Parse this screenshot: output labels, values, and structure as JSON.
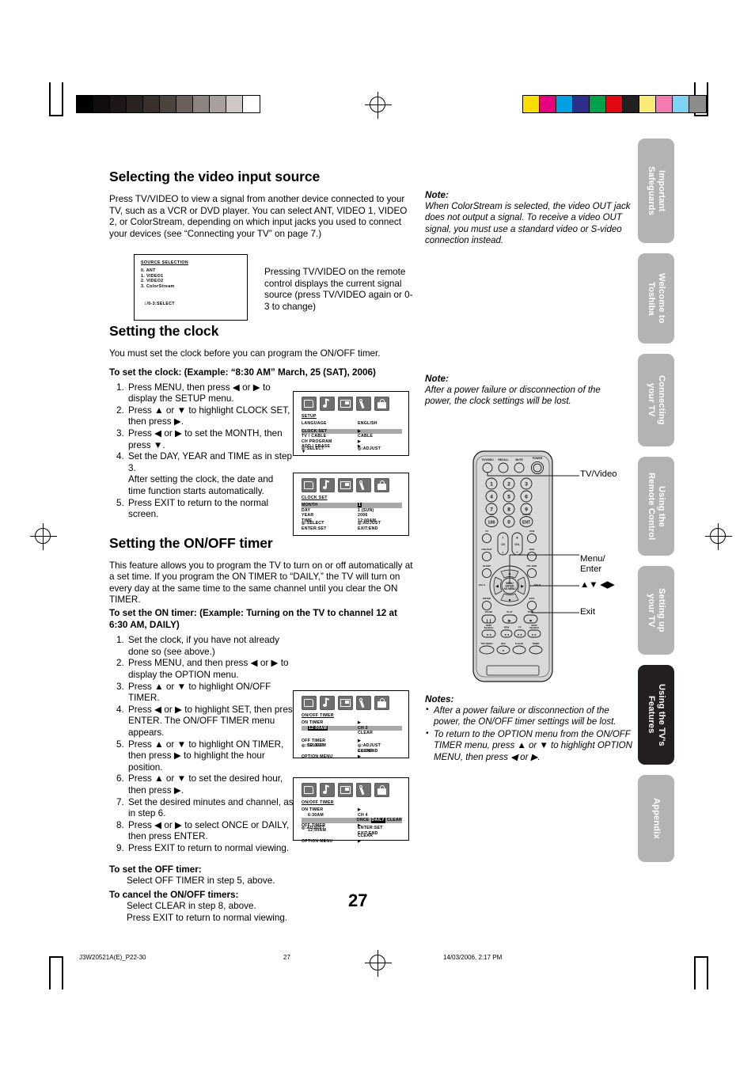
{
  "page": {
    "number": "27",
    "footer_left": "J3W20521A(E)_P22-30",
    "footer_center": "27",
    "footer_right": "14/03/2006, 2:17 PM"
  },
  "sidebar": {
    "tabs": [
      {
        "label": "Important\nSafeguards",
        "active": false
      },
      {
        "label": "Welcome to\nToshiba",
        "active": false
      },
      {
        "label": "Connecting\nyour TV",
        "active": false
      },
      {
        "label": "Using the\nRemote Control",
        "active": false
      },
      {
        "label": "Setting up\nyour TV",
        "active": false
      },
      {
        "label": "Using the TV's\nFeatures",
        "active": true
      },
      {
        "label": "Appendix",
        "active": false
      }
    ]
  },
  "section_video_input": {
    "heading": "Selecting the video input source",
    "paragraph": "Press TV/VIDEO to view a signal from another device connected to your TV, such as a VCR or DVD player. You can select ANT, VIDEO 1, VIDEO 2, or ColorStream, depending on which input jacks you used to connect your devices (see “Connecting your TV” on page 7.)",
    "caption": "Pressing TV/VIDEO on the remote control displays the current signal source (press TV/VIDEO again or 0-3 to change)",
    "osd": {
      "title": "SOURCE SELECTION",
      "items": [
        "0. ANT",
        "1. VIDEO1",
        "2. VIDEO2",
        "3. ColorStream"
      ],
      "footer": "0-3:SELECT"
    }
  },
  "note_colorstream": {
    "title": "Note:",
    "body": "When ColorStream is selected, the video OUT jack does not output a signal. To receive a video OUT signal, you must use a standard video or S-video connection instead."
  },
  "section_clock": {
    "heading": "Setting the clock",
    "paragraph": "You must set the clock before you can program the ON/OFF timer.",
    "subheading": "To set the clock: (Example: “8:30 AM” March, 25 (SAT), 2006)",
    "steps": [
      "Press MENU, then press ◀ or ▶ to display the SETUP menu.",
      "Press ▲ or ▼ to highlight CLOCK SET, then press ▶.",
      "Press ◀ or ▶ to set the MONTH, then press ▼.",
      "Set the DAY, YEAR and TIME as in step 3.",
      "Press EXIT to return to the normal screen."
    ],
    "step4_extra": "After setting the clock, the date and time function starts automatically.",
    "osd_setup": {
      "title": "SETUP",
      "rows": [
        {
          "label": "LANGUAGE",
          "value": "ENGLISH",
          "highlight": false
        },
        {
          "label": "CLOCK SET",
          "value": "▶",
          "highlight": true
        },
        {
          "label": "TV / CABLE",
          "value": "CABLE",
          "highlight": false
        },
        {
          "label": "CH PROGRAM",
          "value": "▶",
          "highlight": false
        },
        {
          "label": "ADD / ERASE",
          "value": "▶",
          "highlight": false
        },
        {
          "label": "▼",
          "value": "",
          "highlight": false
        }
      ],
      "footer_left": ":SELECT",
      "footer_right": ":ADJUST"
    },
    "osd_clock": {
      "title": "CLOCK SET",
      "rows": [
        {
          "label": "MONTH",
          "value": "1",
          "highlight": true
        },
        {
          "label": "DAY",
          "value": "1 (SUN)",
          "highlight": false
        },
        {
          "label": "YEAR",
          "value": "2006",
          "highlight": false
        },
        {
          "label": "TIME",
          "value": "12:00AM",
          "highlight": false
        }
      ],
      "footer_left_1": ":SELECT",
      "footer_left_2": "ENTER:SET",
      "footer_right_1": ":ADJUST",
      "footer_right_2": "EXIT:END"
    }
  },
  "note_clock": {
    "title": "Note:",
    "body": "After a power failure or disconnection of the power, the clock settings will be lost."
  },
  "section_timer": {
    "heading": "Setting the ON/OFF timer",
    "paragraph": "This feature allows you to program the TV to turn on or off automatically at a set time. If you program the ON TIMER to “DAILY,” the TV will turn on every day at the same time to the same channel until you clear the ON TIMER.",
    "subheading": "To set the ON timer: (Example: Turning on the TV to channel 12 at 6:30 AM, DAILY)",
    "steps": [
      "Set the clock, if you have not already done so (see above.)",
      "Press MENU, and then press ◀ or ▶ to display the OPTION menu.",
      "Press ▲ or ▼ to highlight ON/OFF TIMER.",
      "Press ◀ or ▶ to highlight SET, then press ENTER. The ON/OFF TIMER menu appears.",
      "Press ▲ or ▼ to highlight ON TIMER, then press ▶ to highlight the hour position.",
      "Press ▲ or ▼ to set the desired hour, then press ▶.",
      "Set the desired minutes and channel, as in step 6.",
      "Press ◀ or ▶ to select ONCE or DAILY, then press ENTER.",
      "Press EXIT to return to normal viewing."
    ],
    "off_timer_heading": "To set the OFF timer:",
    "off_timer_body": "Select OFF TIMER in step 5, above.",
    "cancel_heading": "To cancel the ON/OFF timers:",
    "cancel_body_1": "Select CLEAR in step 8, above.",
    "cancel_body_2": "Press EXIT to return to normal viewing.",
    "osd_timer_1": {
      "title": "ON/OFF TIMER",
      "on_timer_label": "ON TIMER",
      "on_timer_time": "12:00AM",
      "on_timer_arrow": "▶",
      "on_timer_ch": "CH   3",
      "on_timer_clear": "CLEAR",
      "off_timer_label": "OFF TIMER",
      "off_timer_time": "12:00AM",
      "off_timer_arrow": "▶",
      "off_timer_clear": "CLEAR",
      "option_menu_label": "OPTION MENU",
      "option_menu_arrow": "▶",
      "footer_left": ":SELECT",
      "footer_right_1": ":ADJUST",
      "footer_right_2": "EXIT:END"
    },
    "osd_timer_2": {
      "title": "ON/OFF TIMER",
      "on_timer_label": "ON TIMER",
      "on_timer_time": "6:30AM",
      "on_timer_arrow": "▶",
      "on_timer_ch": "CH   4",
      "mode_once": "ONCE",
      "mode_daily": "DAILY",
      "mode_clear": "CLEAR",
      "off_timer_label": "OFF TIMER",
      "off_timer_time": "12:00AM",
      "off_timer_arrow": "▶",
      "off_timer_clear": "CLEAR",
      "option_menu_label": "OPTION MENU",
      "option_menu_arrow": "▶",
      "footer_left": ":ADJUST",
      "footer_right_1": "ENTER:SET",
      "footer_right_2": "EXIT:END"
    }
  },
  "notes_timer": {
    "title": "Notes:",
    "items": [
      "After a power failure or disconnection of the power, the ON/OFF timer settings will be lost.",
      "To return to the OPTION menu from the ON/OFF TIMER menu, press ▲ or ▼ to highlight OPTION MENU, then press ◀ or ▶."
    ]
  },
  "remote": {
    "callouts": [
      {
        "label": "TV/Video"
      },
      {
        "label": "Menu/\nEnter"
      },
      {
        "label": "▲▼ ◀▶"
      },
      {
        "label": "Exit"
      }
    ],
    "top_buttons": [
      "TV/VIDEO",
      "RECALL",
      "MUTE",
      "POWER"
    ],
    "keypad": [
      "1",
      "2",
      "3",
      "4",
      "5",
      "6",
      "7",
      "8",
      "9",
      "100",
      "0",
      "ENT"
    ],
    "keypad_sub": {
      "100": "+10",
      "ENT": "CH RTN"
    },
    "mode_buttons": [
      "TV",
      "VCR",
      "CBL/SAT",
      "DVD",
      "SLEEP",
      "PIC SIZE"
    ],
    "center_buttons": [
      "CH",
      "VOL",
      "MENU ENTER",
      "NO MENU",
      "FAV A",
      "FAV B",
      "ENTER",
      "EXIT"
    ],
    "transport": [
      "PAUSE",
      "PLAY",
      "STOP",
      "SKIP/SEARCH",
      "REW",
      "FF",
      "SKIP/SEARCH"
    ],
    "bottom": [
      "TOP MENU",
      "REC",
      "CLEAR",
      "TIMER"
    ]
  },
  "colors": {
    "tab_inactive": "#b3b3b3",
    "tab_active": "#231f20",
    "osd_highlight": "#a8a8a8",
    "bar_right": [
      "#fcdd00",
      "#e6007e",
      "#00a0e3",
      "#2d2e8a",
      "#00a14b",
      "#e30613",
      "#231f20",
      "#faea7a",
      "#f47bb0",
      "#7fd3f2",
      "#8c8c8c"
    ]
  }
}
